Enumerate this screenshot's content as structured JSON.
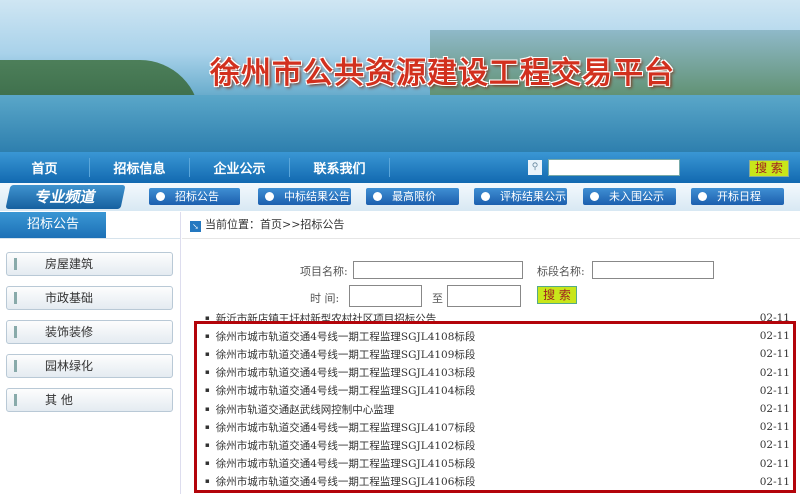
{
  "banner": {
    "title": "徐州市公共资源建设工程交易平台"
  },
  "nav": {
    "items": [
      "首页",
      "招标信息",
      "企业公示",
      "联系我们"
    ],
    "search_icon": "search-icon",
    "search_value": "",
    "search_button": "搜 索"
  },
  "channel": {
    "label": "专业频道",
    "buttons": [
      "招标公告",
      "中标结果公告",
      "最高限价",
      "评标结果公示",
      "未入围公示",
      "开标日程"
    ]
  },
  "sidebar": {
    "header": "招标公告",
    "items": [
      "房屋建筑",
      "市政基础",
      "装饰装修",
      "园林绿化",
      "其 他"
    ]
  },
  "breadcrumb": "当前位置：首页>>招标公告",
  "form": {
    "project_label": "项目名称:",
    "section_label": "标段名称:",
    "time_label": "时 间:",
    "to_label": "至",
    "search_button": "搜 索",
    "project_value": "",
    "section_value": "",
    "time_from": "",
    "time_to": ""
  },
  "list": [
    {
      "title": "新沂市新店镇王圩村新型农村社区项目招标公告",
      "date": "02-11"
    },
    {
      "title": "徐州市城市轨道交通4号线一期工程监理SGJL4108标段",
      "date": "02-11"
    },
    {
      "title": "徐州市城市轨道交通4号线一期工程监理SGJL4109标段",
      "date": "02-11"
    },
    {
      "title": "徐州市城市轨道交通4号线一期工程监理SGJL4103标段",
      "date": "02-11"
    },
    {
      "title": "徐州市城市轨道交通4号线一期工程监理SGJL4104标段",
      "date": "02-11"
    },
    {
      "title": "徐州市轨道交通赵武线网控制中心监理",
      "date": "02-11"
    },
    {
      "title": "徐州市城市轨道交通4号线一期工程监理SGJL4107标段",
      "date": "02-11"
    },
    {
      "title": "徐州市城市轨道交通4号线一期工程监理SGJL4102标段",
      "date": "02-11"
    },
    {
      "title": "徐州市城市轨道交通4号线一期工程监理SGJL4105标段",
      "date": "02-11"
    },
    {
      "title": "徐州市城市轨道交通4号线一期工程监理SGJL4106标段",
      "date": "02-11"
    }
  ],
  "colors": {
    "nav": "#1a73b8",
    "highlight": "#b3040a",
    "search_button": "#c8e61a"
  }
}
